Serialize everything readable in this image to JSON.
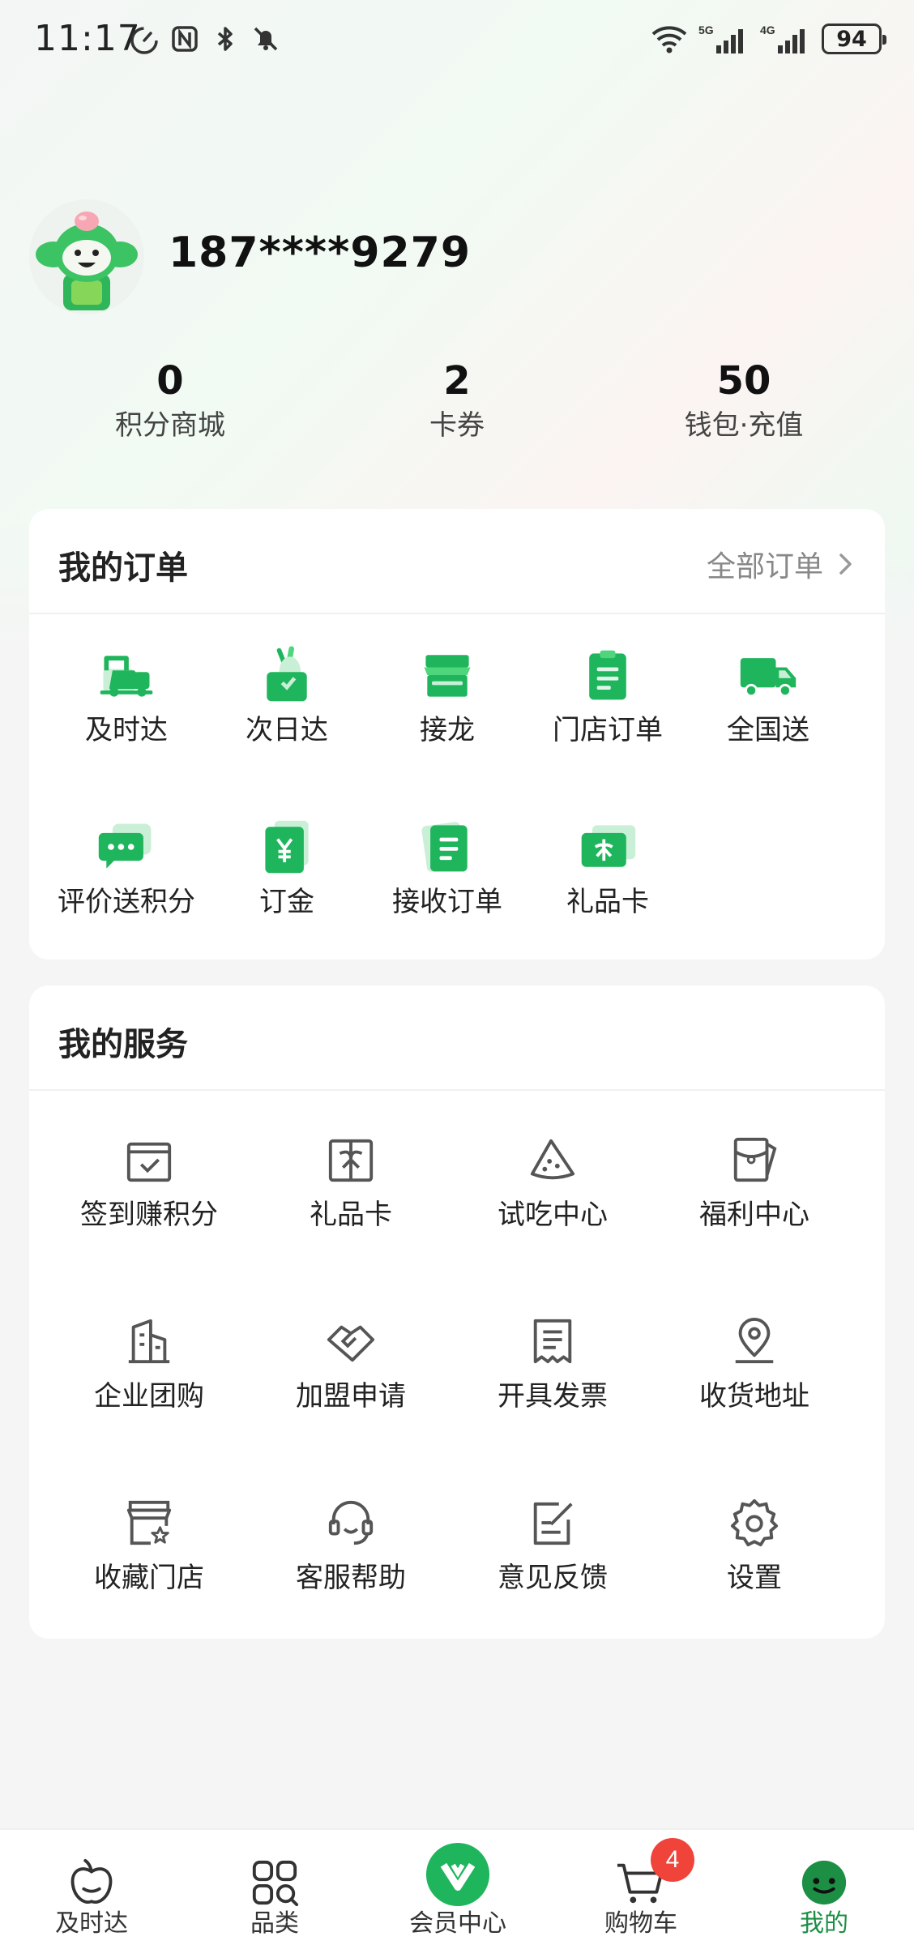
{
  "status_bar": {
    "time": "11:17",
    "battery": "94",
    "signal_labels": [
      "5G",
      "4G"
    ],
    "icons": [
      "speed-icon",
      "nfc-icon",
      "bluetooth-icon",
      "mute-icon",
      "wifi-icon",
      "signal-icon",
      "battery-icon"
    ]
  },
  "profile": {
    "phone": "187****9279",
    "avatar_icon": "mascot-avatar-icon"
  },
  "stats": [
    {
      "value": "0",
      "label": "积分商城"
    },
    {
      "value": "2",
      "label": "卡券"
    },
    {
      "value": "50",
      "label": "钱包·充值"
    }
  ],
  "orders": {
    "title": "我的订单",
    "more_label": "全部订单",
    "items": [
      {
        "label": "及时达",
        "icon": "scooter-icon"
      },
      {
        "label": "次日达",
        "icon": "vegetable-bag-icon"
      },
      {
        "label": "接龙",
        "icon": "store-icon"
      },
      {
        "label": "门店订单",
        "icon": "clipboard-icon"
      },
      {
        "label": "全国送",
        "icon": "truck-icon"
      },
      {
        "label": "评价送积分",
        "icon": "comment-icon"
      },
      {
        "label": "订金",
        "icon": "yuan-card-icon"
      },
      {
        "label": "接收订单",
        "icon": "document-icon"
      },
      {
        "label": "礼品卡",
        "icon": "gift-card-icon"
      }
    ]
  },
  "services": {
    "title": "我的服务",
    "items": [
      {
        "label": "签到赚积分",
        "icon": "checkin-calendar-icon"
      },
      {
        "label": "礼品卡",
        "icon": "gift-box-icon"
      },
      {
        "label": "试吃中心",
        "icon": "watermelon-icon"
      },
      {
        "label": "福利中心",
        "icon": "welfare-envelope-icon"
      },
      {
        "label": "企业团购",
        "icon": "building-icon"
      },
      {
        "label": "加盟申请",
        "icon": "handshake-icon"
      },
      {
        "label": "开具发票",
        "icon": "invoice-icon"
      },
      {
        "label": "收货地址",
        "icon": "location-pin-icon"
      },
      {
        "label": "收藏门店",
        "icon": "favorite-store-icon"
      },
      {
        "label": "客服帮助",
        "icon": "headset-icon"
      },
      {
        "label": "意见反馈",
        "icon": "feedback-edit-icon"
      },
      {
        "label": "设置",
        "icon": "gear-icon"
      }
    ]
  },
  "bottom_nav": {
    "items": [
      {
        "label": "及时达",
        "icon": "fruit-icon"
      },
      {
        "label": "品类",
        "icon": "category-grid-icon"
      },
      {
        "label": "会员中心",
        "icon": "member-v-icon"
      },
      {
        "label": "购物车",
        "icon": "cart-icon"
      },
      {
        "label": "我的",
        "icon": "smile-face-icon"
      }
    ],
    "cart_badge": "4",
    "active_index": 4
  },
  "colors": {
    "brand_green": "#1fb55c",
    "dark_green": "#1c8f45",
    "badge_red": "#f0433a"
  }
}
